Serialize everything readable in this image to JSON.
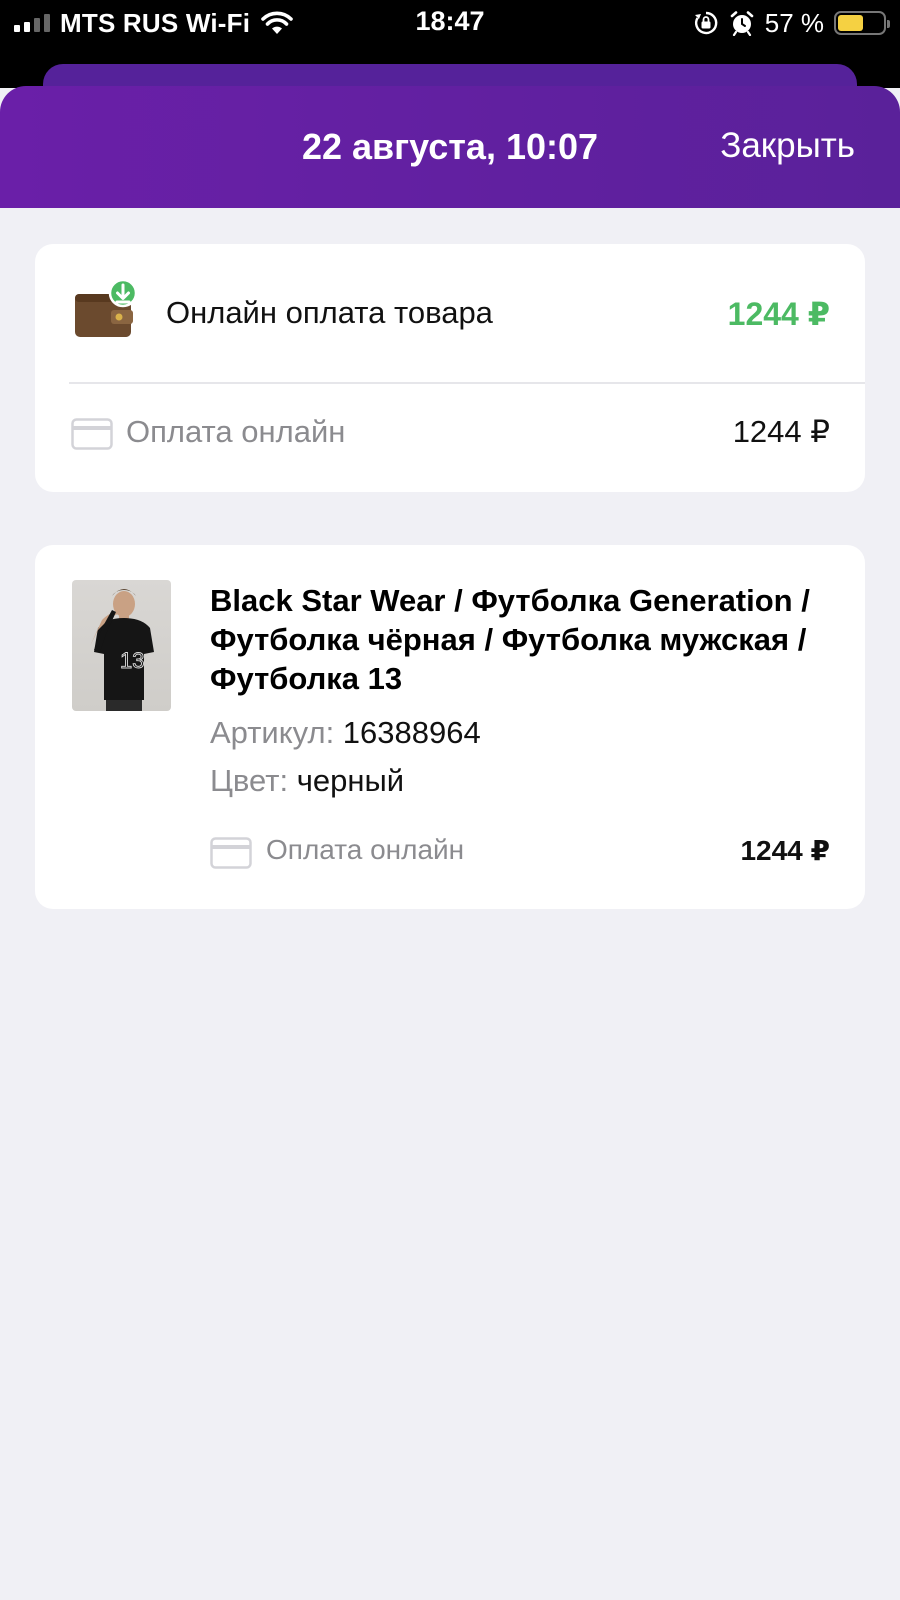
{
  "status_bar": {
    "carrier": "MTS RUS Wi-Fi",
    "time": "18:47",
    "battery_percent_label": "57 %",
    "battery_level": 0.57,
    "signal_bars_active": 2,
    "icons": [
      "signal-icon",
      "wifi-icon",
      "orientation-lock-icon",
      "alarm-icon",
      "battery-icon"
    ]
  },
  "header": {
    "title": "22 августа, 10:07",
    "close_label": "Закрыть",
    "color": "#5c2098"
  },
  "payment_card": {
    "icon": "wallet-download-icon",
    "title": "Онлайн оплата товара",
    "amount": "1244 ₽",
    "amount_color": "#4cba63",
    "method_icon": "card-icon",
    "method_label": "Оплата онлайн",
    "method_amount": "1244 ₽"
  },
  "product_card": {
    "image": "product-photo",
    "title": "Black Star Wear / Футболка Generation / Футболка чёрная / Футболка мужская / Футболка 13",
    "article_key": "Артикул:",
    "article_value": "16388964",
    "color_key": "Цвет:",
    "color_value": "черный",
    "method_icon": "card-icon",
    "method_label": "Оплата онлайн",
    "method_amount": "1244 ₽"
  }
}
